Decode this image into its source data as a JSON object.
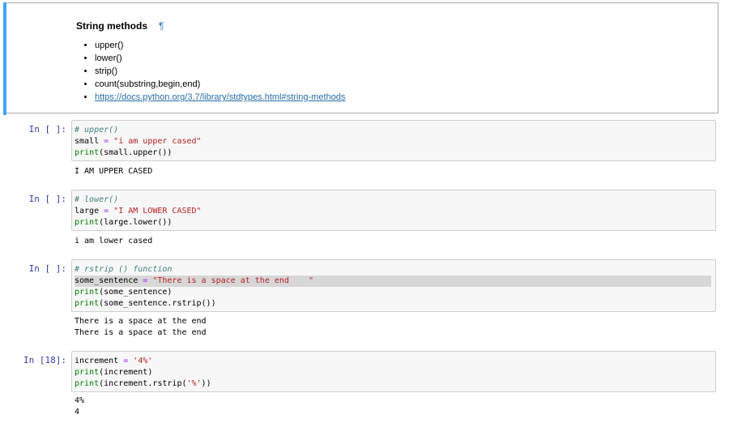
{
  "markdown": {
    "title": "String methods",
    "anchor_symbol": "¶",
    "items": [
      "upper()",
      "lower()",
      "strip()",
      "count(substring,begin,end)"
    ],
    "link": "https://docs.python.org/3.7/library/stdtypes.html#string-methods"
  },
  "cells": [
    {
      "prompt": "In [ ]:",
      "code": {
        "comment": "# upper()",
        "line2": {
          "var": "small",
          "eq": " = ",
          "str": "\"i am upper cased\""
        },
        "line3": {
          "fn": "print",
          "rest": "(small.upper())"
        }
      },
      "output": [
        "I AM UPPER CASED"
      ]
    },
    {
      "prompt": "In [ ]:",
      "code": {
        "comment": "# lower()",
        "line2": {
          "var": "large",
          "eq": " = ",
          "str": "\"I AM LOWER CASED\""
        },
        "line3": {
          "fn": "print",
          "rest": "(large.lower())"
        }
      },
      "output": [
        "i am lower cased"
      ]
    },
    {
      "prompt": "In [ ]:",
      "code": {
        "comment": "# rstrip () function",
        "line2": {
          "var": "some_sentence",
          "eq": " = ",
          "str": "\"There is a space at the end    \""
        },
        "line3": {
          "fn": "print",
          "rest": "(some_sentence)"
        },
        "line4": {
          "fn": "print",
          "rest": "(some_sentence.rstrip())"
        }
      },
      "output": [
        "There is a space at the end",
        "There is a space at the end"
      ]
    },
    {
      "prompt": "In [18]:",
      "code": {
        "line1": {
          "var": "increment",
          "eq": " = ",
          "str": "'4%'"
        },
        "line2": {
          "fn": "print",
          "rest": "(increment)"
        },
        "line3": {
          "fn": "print",
          "pre": "(increment.rstrip(",
          "str": "'%'",
          "post": "))"
        }
      },
      "output": [
        "4%",
        "4"
      ]
    }
  ]
}
